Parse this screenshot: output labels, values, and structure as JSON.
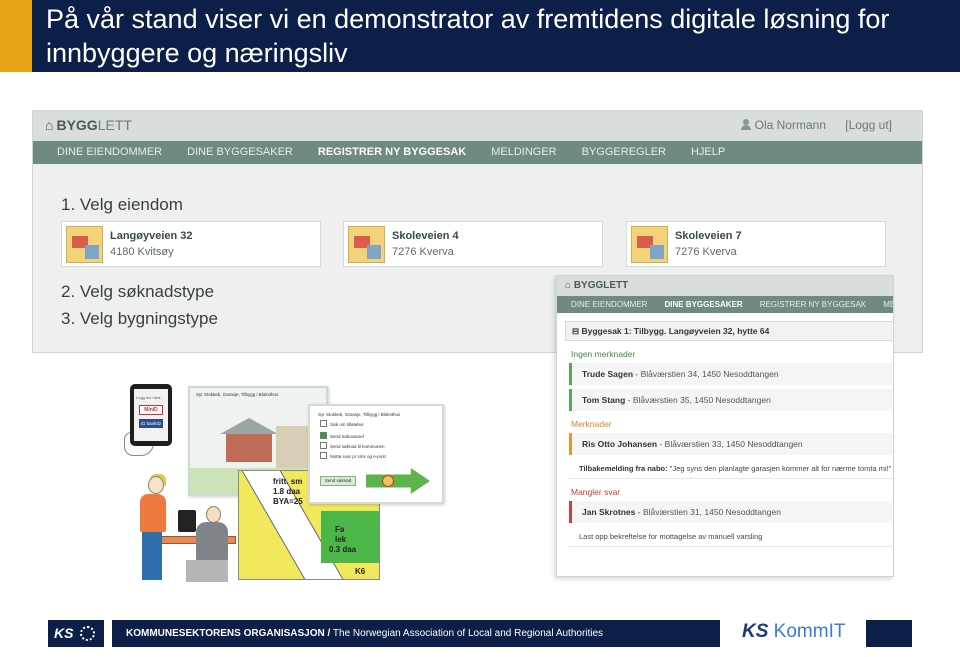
{
  "slide": {
    "title": "På vår stand viser vi en demonstrator av fremtidens digitale løsning for innbyggere og næringsliv"
  },
  "app": {
    "brand_bold": "BYGG",
    "brand_light": "LETT",
    "user_name": "Ola Normann",
    "logout_label": "[Logg ut]",
    "nav": [
      {
        "label": "DINE EIENDOMMER"
      },
      {
        "label": "DINE BYGGESAKER"
      },
      {
        "label": "REGISTRER NY BYGGESAK"
      },
      {
        "label": "MELDINGER"
      },
      {
        "label": "BYGGEREGLER"
      },
      {
        "label": "HJELP"
      }
    ],
    "steps": {
      "step1": "1. Velg eiendom",
      "step2": "2. Velg søknadstype",
      "step3": "3. Velg bygningstype"
    },
    "properties": [
      {
        "name": "Langøyveien 32",
        "address": "4180 Kvitsøy"
      },
      {
        "name": "Skoleveien 4",
        "address": "7276 Kverva"
      },
      {
        "name": "Skoleveien 7",
        "address": "7276 Kverva"
      }
    ]
  },
  "app2": {
    "brand": "BYGGLETT",
    "nav": [
      {
        "label": "DINE EIENDOMMER"
      },
      {
        "label": "DINE BYGGESAKER"
      },
      {
        "label": "REGISTRER NY BYGGESAK"
      },
      {
        "label": "MELDINGER"
      }
    ],
    "case_title": "Byggesak 1: Tilbygg. Langøyveien 32, hytte 64",
    "section_no_remarks": "Ingen merknader",
    "section_remarks": "Merknader",
    "section_missing": "Mangler svar",
    "rows_no_remarks": [
      {
        "name": "Trude Sagen",
        "addr": " - Blåværstien 34, 1450 Nesoddtangen"
      },
      {
        "name": "Tom Stang",
        "addr": " - Blåværstien 35, 1450 Nesoddtangen"
      }
    ],
    "row_remark": {
      "name": "Ris Otto Johansen",
      "addr": " - Blåværstien 33, 1450 Nesoddtangen"
    },
    "remark_note_label": "Tilbakemelding fra nabo:",
    "remark_note_text": " \"Jeg syns den planlagte garasjen kommer alt for nærme tomta mi!\"",
    "row_missing": {
      "name": "Jan Skrotnes",
      "addr": " - Blåværstien 31, 1450 Nesoddtangen"
    },
    "missing_note": "Last opp bekreftelse for mottagelse av manuell varsling"
  },
  "illustration": {
    "tablet_login": "Logg inn med:",
    "minid": "MinID",
    "bankid": "iD bankID",
    "screen1_header": "Syr Stokkeb, Garasje, Tilbygg i Bloksthus",
    "screen2_header": "Syr Stokkeb, Garasje, Tilbygg i Bloksthus",
    "screen2_sub": "Søk om tillatelse:",
    "opt1": "Send nabovarsel",
    "opt2": "Send søknad til kommunen",
    "opt3": "Motta svar pr sms og e-post",
    "send_button": "Send søknad",
    "map_labels": {
      "l1": "fritt. sm",
      "l2": "1.8 daa",
      "l3": "BYA=25",
      "l4": "Fa",
      "l5": "lek",
      "l6": "0.3 daa",
      "l7": "K6"
    }
  },
  "footer": {
    "ks": "KS",
    "org_bold": "KOMMUNESEKTORENS ORGANISASJON /",
    "org_rest": " The Norwegian Association of Local and Regional Authorities",
    "kommit_ks": "KS",
    "kommit_rest": " KommIT"
  },
  "colors": {
    "header_bg": "#0b1f49",
    "accent_orange": "#e8a317",
    "nav_green": "#6e8a82",
    "ok_green": "#5aa55a",
    "remark_orange": "#e09538",
    "missing_red": "#c84141"
  }
}
